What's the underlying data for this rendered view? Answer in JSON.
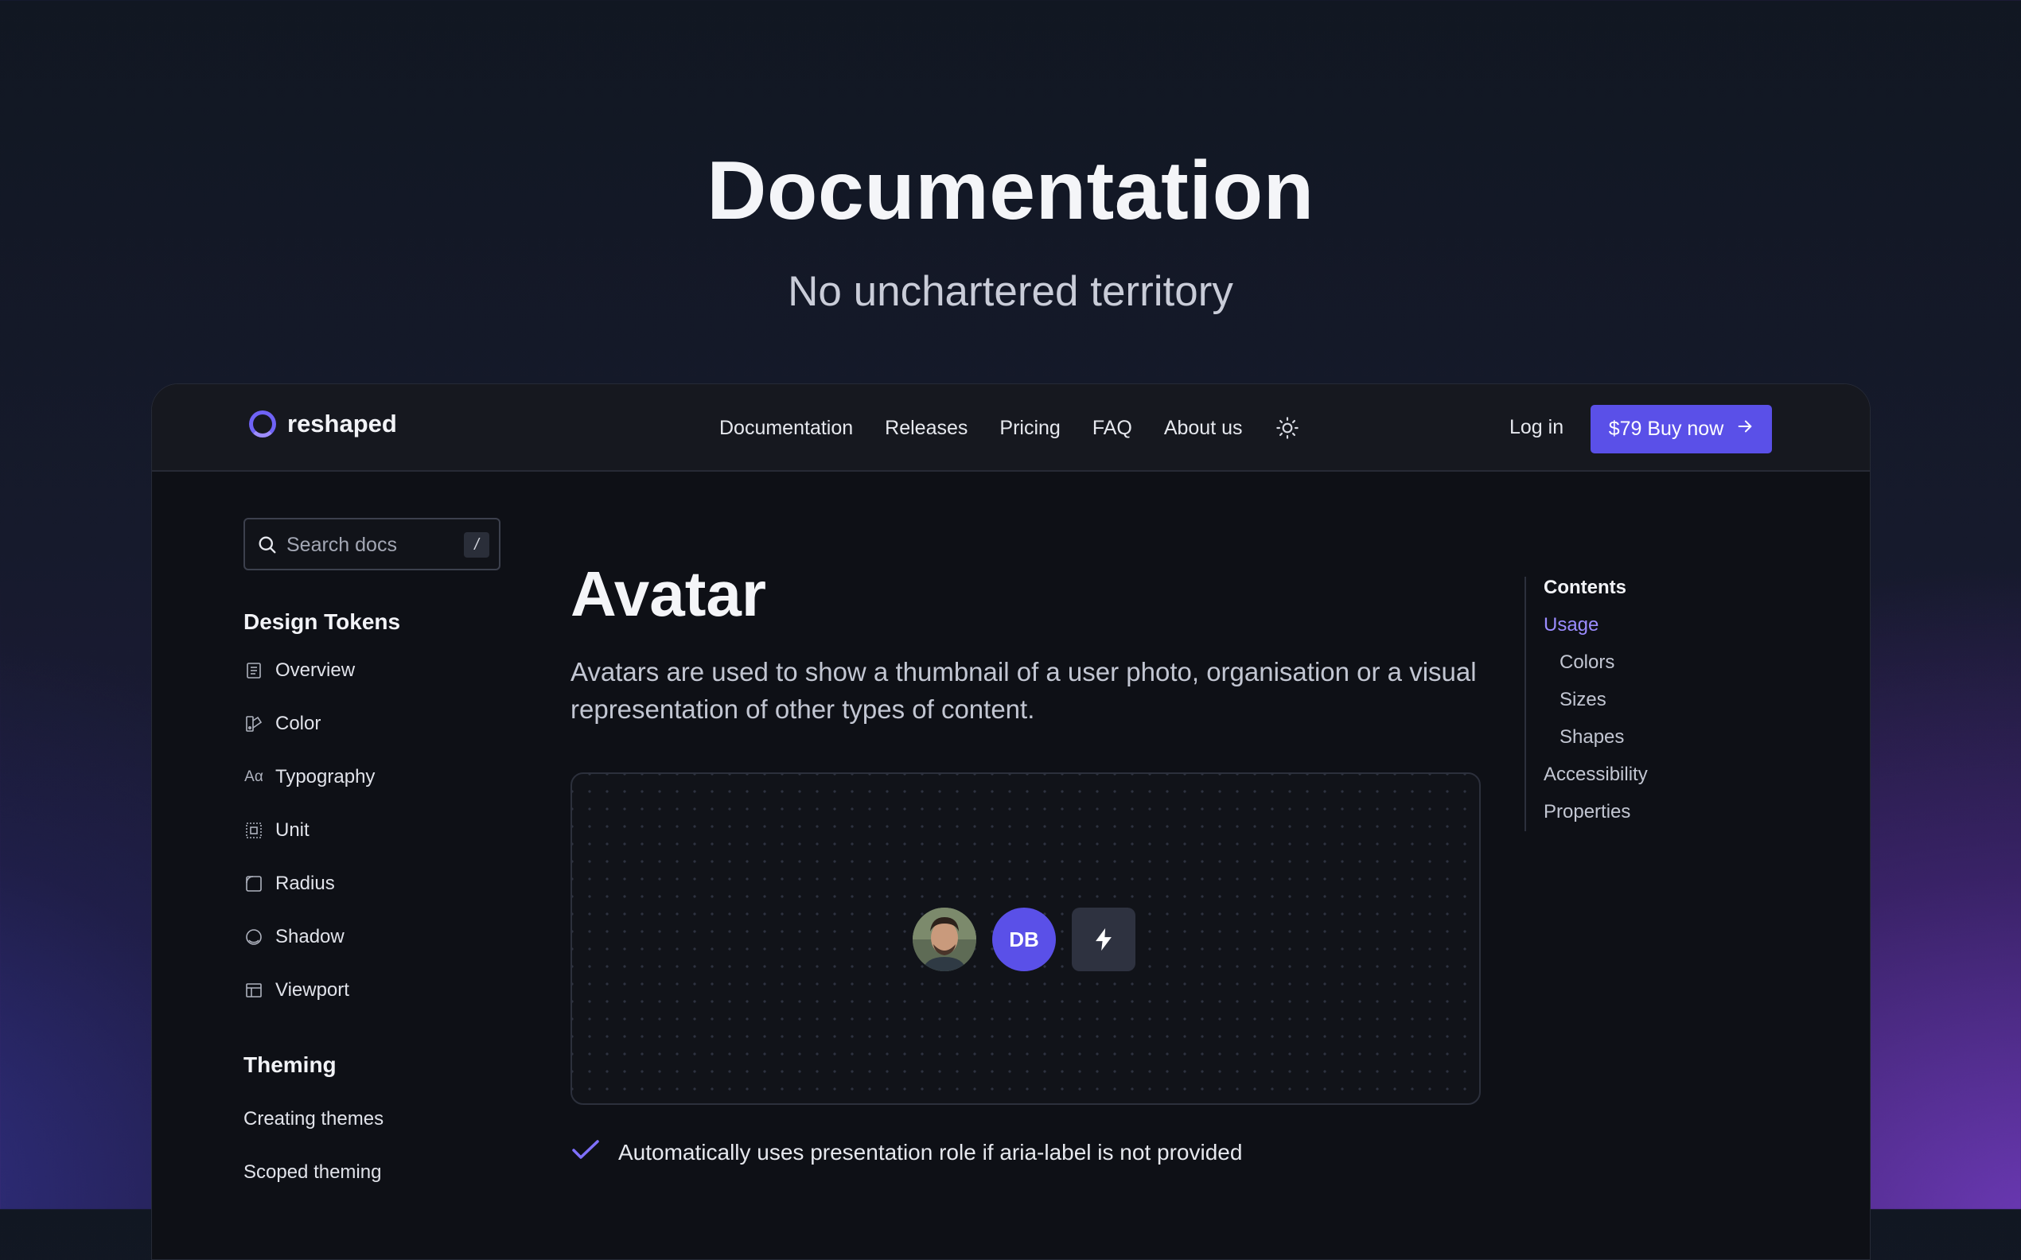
{
  "hero": {
    "title": "Documentation",
    "subtitle": "No unchartered territory"
  },
  "header": {
    "logo_text": "reshaped",
    "nav": [
      "Documentation",
      "Releases",
      "Pricing",
      "FAQ",
      "About us"
    ],
    "login": "Log in",
    "buy": "$79 Buy now"
  },
  "search": {
    "placeholder": "Search docs",
    "shortcut": "/"
  },
  "sidebar": {
    "design_tokens_heading": "Design Tokens",
    "items": [
      {
        "label": "Overview",
        "icon": "document-icon"
      },
      {
        "label": "Color",
        "icon": "palette-icon"
      },
      {
        "label": "Typography",
        "icon": "typography-icon"
      },
      {
        "label": "Unit",
        "icon": "unit-icon"
      },
      {
        "label": "Radius",
        "icon": "radius-icon"
      },
      {
        "label": "Shadow",
        "icon": "shadow-icon"
      },
      {
        "label": "Viewport",
        "icon": "viewport-icon"
      }
    ],
    "theming_heading": "Theming",
    "theming_items": [
      "Creating themes",
      "Scoped theming"
    ]
  },
  "main": {
    "title": "Avatar",
    "description": "Avatars are used to show a thumbnail of a user photo, organisation or a visual representation of other types of content.",
    "avatar_initials": "DB",
    "feature": "Automatically uses presentation role if aria-label is not provided"
  },
  "toc": {
    "title": "Contents",
    "items": [
      "Usage",
      "Colors",
      "Sizes",
      "Shapes",
      "Accessibility",
      "Properties"
    ],
    "active": "Usage"
  },
  "colors": {
    "accent": "#5a50e8",
    "active_link": "#9b8cff"
  }
}
